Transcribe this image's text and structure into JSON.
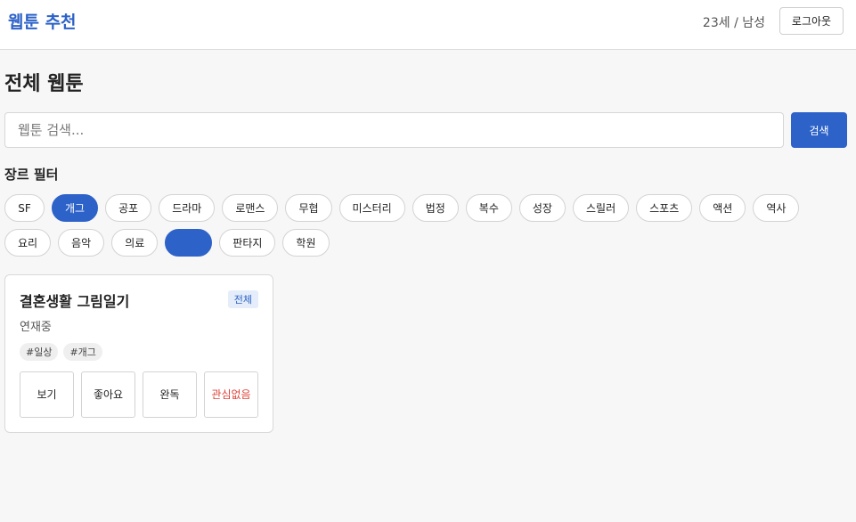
{
  "header": {
    "brand": "웹툰 추천",
    "user_info": "23세 / 남성",
    "logout_label": "로그아웃"
  },
  "main": {
    "title": "전체 웹툰",
    "search": {
      "placeholder": "웹툰 검색...",
      "value": "",
      "button_label": "검색"
    },
    "filter_title": "장르 필터",
    "genres": [
      {
        "label": "SF",
        "selected": false
      },
      {
        "label": "개그",
        "selected": true
      },
      {
        "label": "공포",
        "selected": false
      },
      {
        "label": "드라마",
        "selected": false
      },
      {
        "label": "로맨스",
        "selected": false
      },
      {
        "label": "무협",
        "selected": false
      },
      {
        "label": "미스터리",
        "selected": false
      },
      {
        "label": "법정",
        "selected": false
      },
      {
        "label": "복수",
        "selected": false
      },
      {
        "label": "성장",
        "selected": false
      },
      {
        "label": "스릴러",
        "selected": false
      },
      {
        "label": "스포츠",
        "selected": false
      },
      {
        "label": "액션",
        "selected": false
      },
      {
        "label": "역사",
        "selected": false
      },
      {
        "label": "요리",
        "selected": false
      },
      {
        "label": "음악",
        "selected": false
      },
      {
        "label": "의료",
        "selected": false
      },
      {
        "label": "",
        "selected": true
      },
      {
        "label": "판타지",
        "selected": false
      },
      {
        "label": "학원",
        "selected": false
      }
    ],
    "card": {
      "title": "결혼생활 그림일기",
      "badge": "전체",
      "status": "연재중",
      "tags": [
        "#일상",
        "#개그"
      ],
      "actions": {
        "view": "보기",
        "like": "좋아요",
        "done": "완독",
        "not_interested": "관심없음"
      }
    }
  },
  "colors": {
    "accent": "#2d62c8",
    "danger": "#e0433a",
    "badge_bg": "#e4edf9"
  }
}
